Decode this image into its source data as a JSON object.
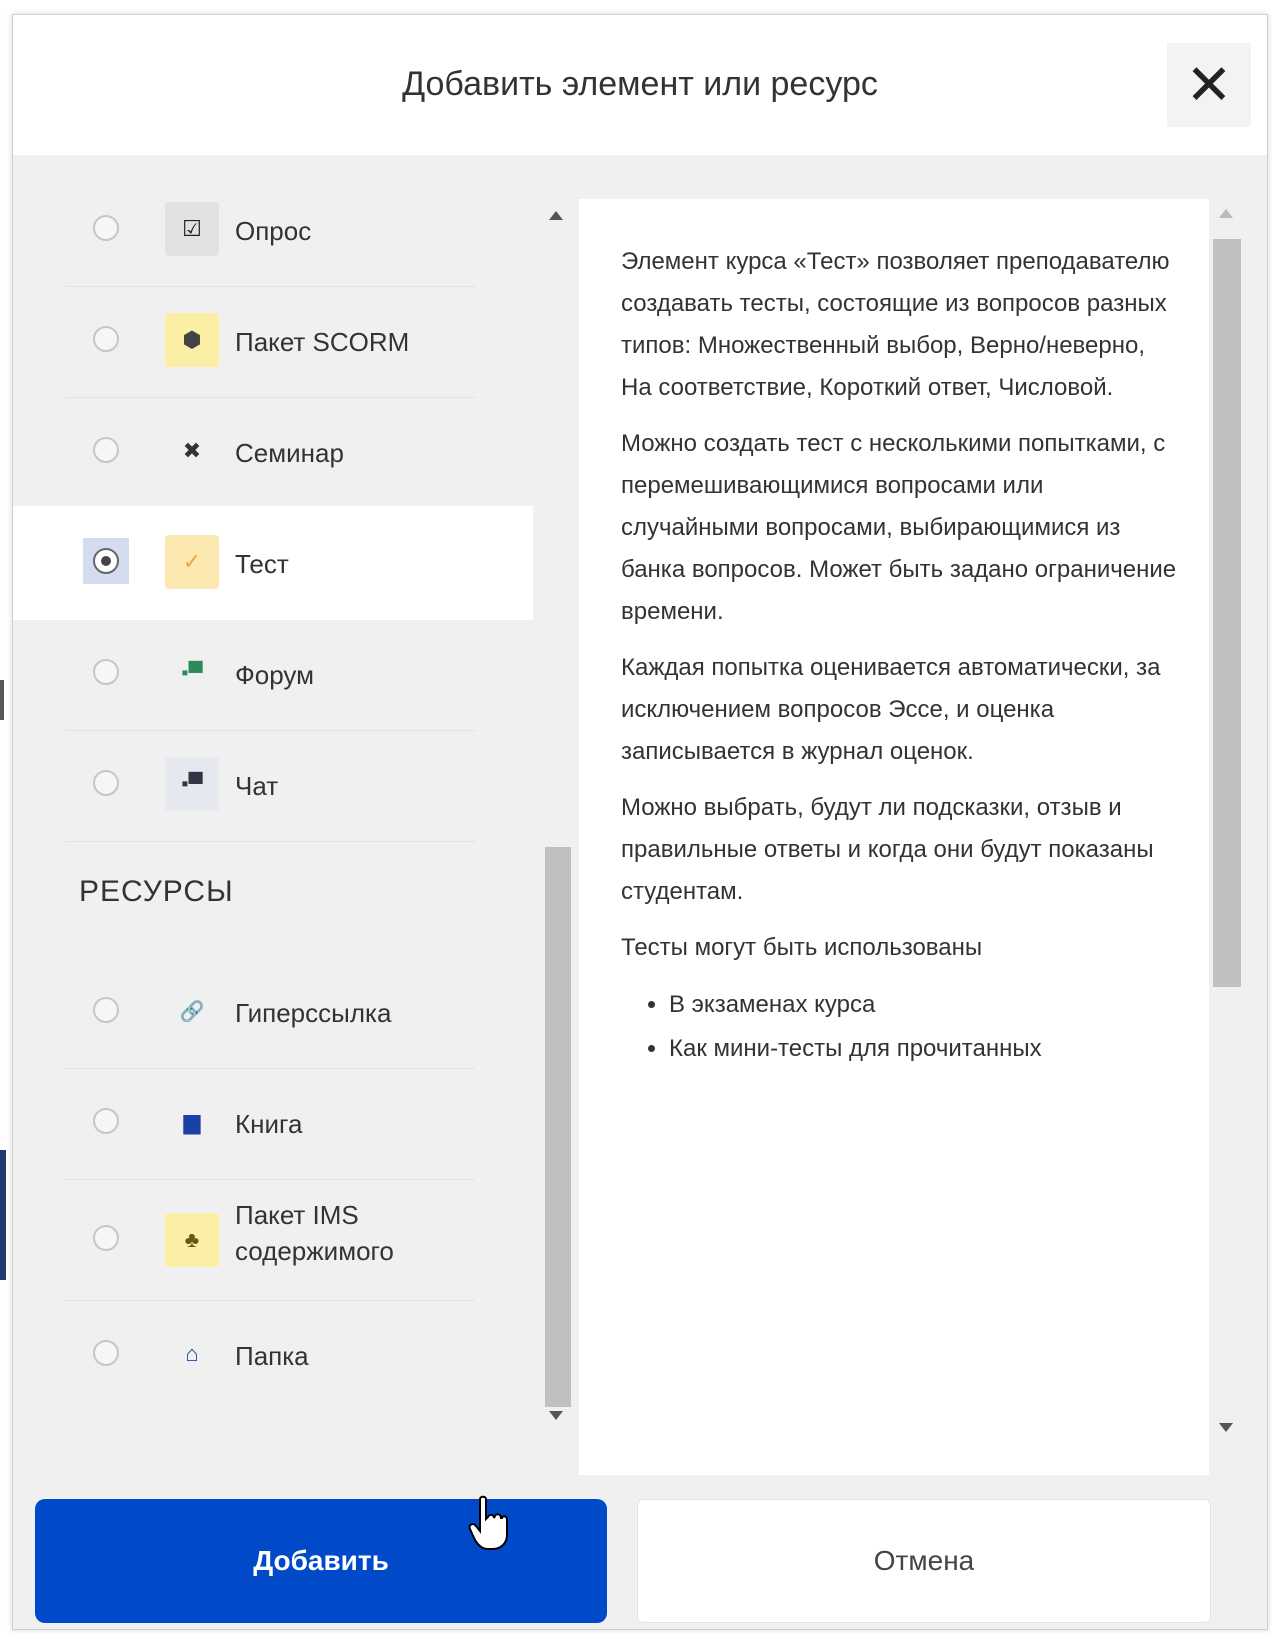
{
  "dialog": {
    "title": "Добавить элемент или ресурс",
    "close_glyph": "✕"
  },
  "activities": [
    {
      "label": "Опрос",
      "icon": "checkbox-icon",
      "glyph": "☑",
      "icon_bg": "#e2e2e2",
      "icon_color": "#222",
      "selected": false
    },
    {
      "label": "Пакет SCORM",
      "icon": "package-icon",
      "glyph": "⬢",
      "icon_bg": "#fbefa5",
      "icon_color": "#444",
      "selected": false
    },
    {
      "label": "Семинар",
      "icon": "tools-icon",
      "glyph": "✖",
      "icon_bg": "transparent",
      "icon_color": "#333",
      "selected": false
    },
    {
      "label": "Тест",
      "icon": "check-icon",
      "glyph": "✓",
      "icon_bg": "#fbe9b0",
      "icon_color": "#f0a34c",
      "selected": true
    },
    {
      "label": "Форум",
      "icon": "forum-icon",
      "glyph": "▪▀",
      "icon_bg": "transparent",
      "icon_color": "#2e8a5c",
      "selected": false
    },
    {
      "label": "Чат",
      "icon": "chat-icon",
      "glyph": "▪▀",
      "icon_bg": "#e6e8f0",
      "icon_color": "#334",
      "selected": false
    }
  ],
  "resources_section": {
    "title": "РЕСУРСЫ"
  },
  "resources": [
    {
      "label": "Гиперссылка",
      "icon": "link-icon",
      "glyph": "🔗",
      "icon_bg": "transparent",
      "icon_color": "#2456b8",
      "selected": false
    },
    {
      "label": "Книга",
      "icon": "book-icon",
      "glyph": "▆",
      "icon_bg": "transparent",
      "icon_color": "#1d3fa8",
      "selected": false
    },
    {
      "label_line1": "Пакет IMS",
      "label_line2": "содержимого",
      "icon": "ims-package-icon",
      "glyph": "♣",
      "icon_bg": "#fbefa5",
      "icon_color": "#6a5a10",
      "selected": false
    },
    {
      "label": "Папка",
      "icon": "folder-icon",
      "glyph": "⌂",
      "icon_bg": "transparent",
      "icon_color": "#1d3fa8",
      "selected": false
    }
  ],
  "description": {
    "p1": "Элемент курса «Тест» позволяет преподавателю создавать тесты, состоящие из вопросов разных типов: Множественный выбор, Верно/неверно, На соответствие, Короткий ответ, Числовой.",
    "p2": "Можно создать тест с несколькими попытками, с перемешивающимися вопросами или случайными вопросами, выбирающимися из банка вопросов. Может быть задано ограничение времени.",
    "p3": "Каждая попытка оценивается автоматически, за исключением вопросов Эссе, и оценка записывается в журнал оценок.",
    "p4": "Можно выбрать, будут ли подсказки, отзыв и правильные ответы и когда они будут показаны студентам.",
    "p5": "Тесты могут быть использованы",
    "bullets": [
      "В экзаменах курса",
      "Как мини-тесты для прочитанных"
    ]
  },
  "footer": {
    "add_label": "Добавить",
    "cancel_label": "Отмена"
  },
  "colors": {
    "primary": "#0049c8",
    "panel_bg": "#f0f0f0"
  }
}
